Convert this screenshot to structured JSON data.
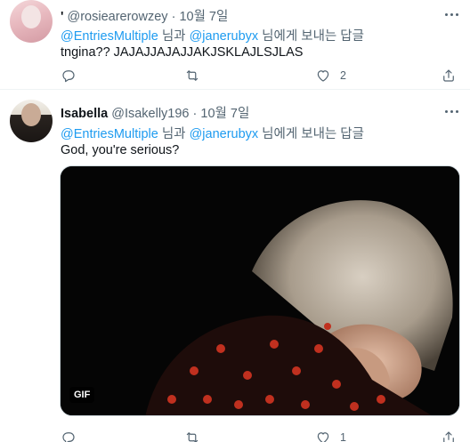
{
  "tweets": [
    {
      "display_name": "'",
      "handle": "@rosiearerowzey",
      "separator": "·",
      "date": "10월 7일",
      "reply_to": {
        "mention1": "@EntriesMultiple",
        "conj": " 님과 ",
        "mention2": "@janerubyx",
        "suffix": " 님에게 보내는 답글"
      },
      "text": "tngina?? JAJAJJAJAJJAKJSKLAJLSJLAS",
      "stats": {
        "replies": "",
        "retweets": "",
        "likes": "2"
      }
    },
    {
      "display_name": "Isabella",
      "handle": "@Isakelly196",
      "separator": "·",
      "date": "10월 7일",
      "reply_to": {
        "mention1": "@EntriesMultiple",
        "conj": " 님과 ",
        "mention2": "@janerubyx",
        "suffix": " 님에게 보내는 답글"
      },
      "text": "God, you're serious?",
      "media": {
        "type": "gif",
        "badge": "GIF"
      },
      "stats": {
        "replies": "",
        "retweets": "",
        "likes": "1"
      }
    }
  ],
  "colors": {
    "link": "#1d9bf0",
    "muted": "#536471",
    "text": "#0f1419",
    "divider": "#eff3f4"
  },
  "icons": [
    "more-icon",
    "reply-icon",
    "retweet-icon",
    "like-icon",
    "share-icon"
  ]
}
